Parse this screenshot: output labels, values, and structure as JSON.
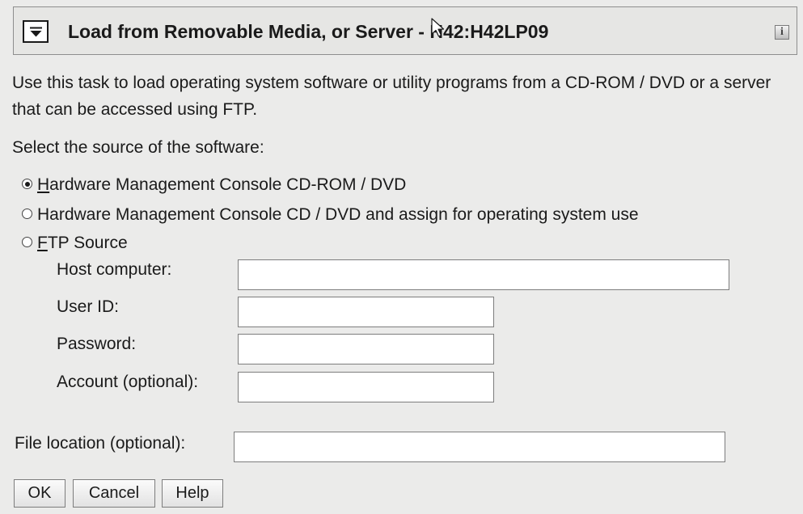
{
  "dialog": {
    "title": "Load from Removable Media, or Server - H42:H42LP09",
    "collapse_icon": "chevron-down-icon",
    "info_icon": "info-icon",
    "info_glyph": "i"
  },
  "description": "Use this task to load operating system software or utility programs from a CD-ROM / DVD or a server that can be accessed using FTP.",
  "source_prompt": "Select the source of the software:",
  "sources": [
    {
      "label": "Hardware Management Console CD-ROM / DVD",
      "mnemonic": "H",
      "selected": true
    },
    {
      "label": "Hardware Management Console CD / DVD and assign for operating system use",
      "mnemonic": "",
      "selected": false
    },
    {
      "label": "FTP Source",
      "mnemonic": "F",
      "selected": false
    }
  ],
  "ftp_fields": {
    "host": {
      "label": "Host computer:",
      "value": ""
    },
    "user": {
      "label": "User ID:",
      "value": ""
    },
    "password": {
      "label": "Password:",
      "value": ""
    },
    "account": {
      "label": "Account (optional):",
      "value": ""
    }
  },
  "file_location": {
    "label": "File location (optional):",
    "value": ""
  },
  "buttons": {
    "ok": "OK",
    "cancel": "Cancel",
    "help": "Help"
  }
}
